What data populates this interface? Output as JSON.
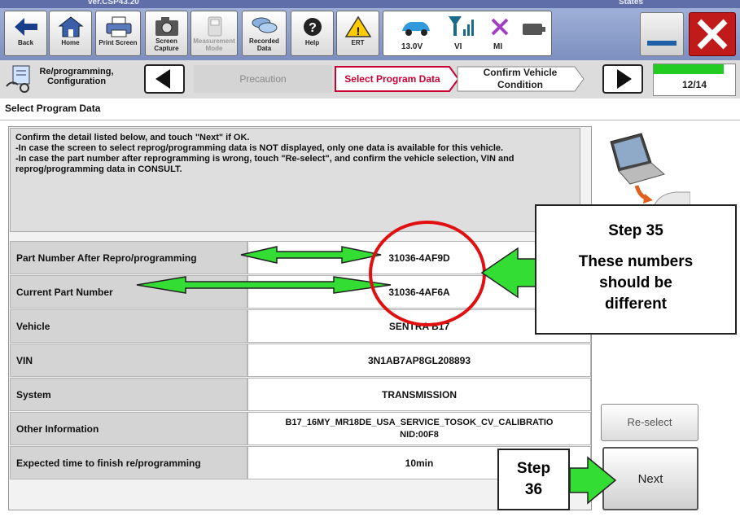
{
  "header": {
    "version": "ver.CSP43.20",
    "region": "States"
  },
  "toolbar": {
    "buttons": [
      {
        "label": "Back"
      },
      {
        "label": "Home"
      },
      {
        "label": "Print Screen"
      },
      {
        "label": "Screen Capture"
      },
      {
        "label": "Measurement Mode"
      },
      {
        "label": "Recorded Data"
      },
      {
        "label": "Help"
      },
      {
        "label": "ERT"
      }
    ],
    "voltage": "13.0V",
    "vi_label": "VI",
    "mi_label": "MI"
  },
  "progress": {
    "section_label": "Re/programming, Configuration",
    "steps": [
      "Precaution",
      "Select Program Data",
      "Confirm Vehicle Condition"
    ],
    "counter": "12/14",
    "fraction": 0.857
  },
  "page": {
    "title": "Select Program Data"
  },
  "instructions": {
    "line1": "Confirm the detail listed below, and touch \"Next\" if OK.",
    "line2": "-In case the screen to select reprog/programming data is NOT displayed, only one data is available for this vehicle.",
    "line3": "-In case the part number after reprogramming is wrong, touch \"Re-select\", and confirm the vehicle selection, VIN and reprog/programming data in CONSULT."
  },
  "details": [
    {
      "label": "Part Number After Repro/programming",
      "value": "31036-4AF9D"
    },
    {
      "label": "Current Part Number",
      "value": "31036-4AF6A"
    },
    {
      "label": "Vehicle",
      "value": "SENTRA B17"
    },
    {
      "label": "VIN",
      "value": "3N1AB7AP8GL208893"
    },
    {
      "label": "System",
      "value": "TRANSMISSION"
    },
    {
      "label": "Other Information",
      "value": "B17_16MY_MR18DE_USA_SERVICE_TOSOK_CV_CALIBRATIO",
      "value2": "NID:00F8"
    },
    {
      "label": "Expected time to finish re/programming",
      "value": "10min"
    }
  ],
  "buttons": {
    "reselect": "Re-select",
    "next": "Next"
  },
  "callouts": {
    "step35_title": "Step 35",
    "step35_line1": "These numbers",
    "step35_line2": "should be",
    "step35_line3": "different",
    "step36_line1": "Step",
    "step36_line2": "36"
  },
  "colors": {
    "toolbar": "#8b9bc9",
    "accent_red": "#cc0033",
    "arrow_green": "#33dd33",
    "progress_green": "#22cc22"
  }
}
